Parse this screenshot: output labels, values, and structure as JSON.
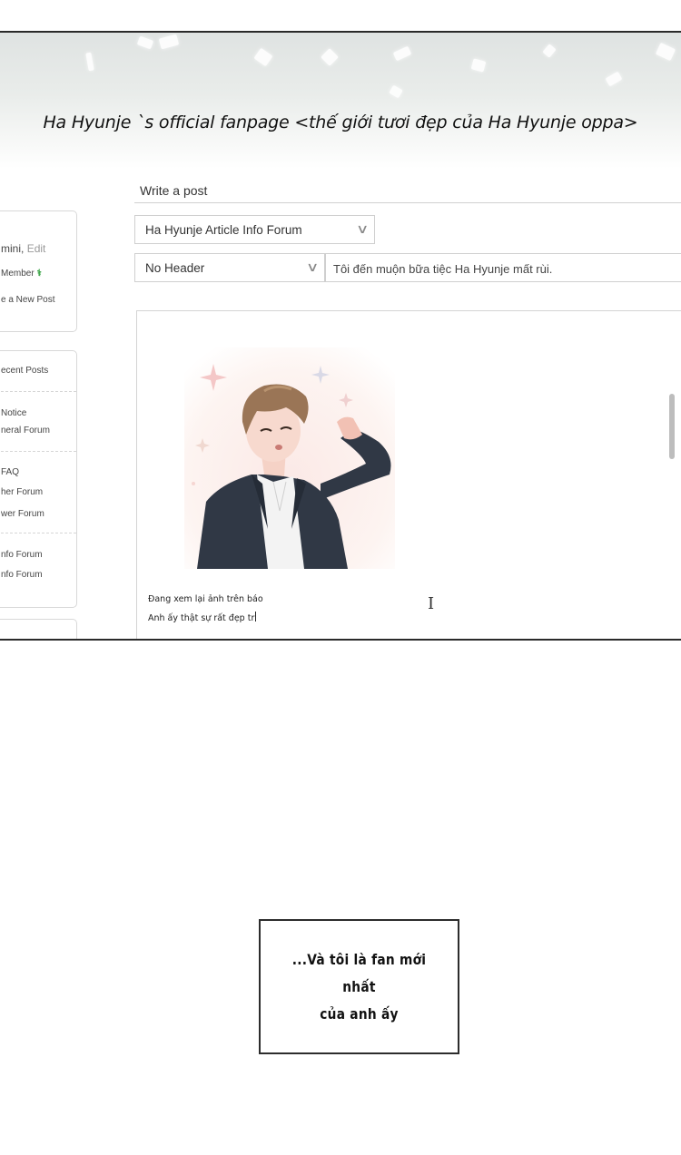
{
  "banner": {
    "caption": "Ha Hyunje `s official fanpage <thế giới tươi đẹp của Ha Hyunje oppa>"
  },
  "sidebar": {
    "profile": {
      "name": "mini,",
      "edit_label": "Edit",
      "member_label": "Member",
      "member_icon": "sprout-icon",
      "new_post_label": "e a New Post"
    },
    "menu": {
      "recent_posts": "ecent Posts",
      "items": [
        "Notice",
        "neral Forum",
        "FAQ",
        "her Forum",
        "wer Forum",
        "nfo Forum",
        "nfo Forum"
      ]
    }
  },
  "write_post": {
    "heading": "Write a post",
    "forum_select": "Ha Hyunje Article Info Forum",
    "header_select": "No Header",
    "title_value": "Tôi đến muộn bữa tiệc Ha Hyunje mất rùi.",
    "body_lines": [
      "Đang xem lại ảnh trên báo",
      "Anh ấy thật sự rất đẹp tr"
    ]
  },
  "speech": {
    "line1": "...Và tôi là fan mới nhất",
    "line2": "của anh ấy"
  },
  "colors": {
    "panel_border": "#2a2a2a",
    "input_border": "#cfcfcf",
    "sprout": "#2e9e3a"
  }
}
